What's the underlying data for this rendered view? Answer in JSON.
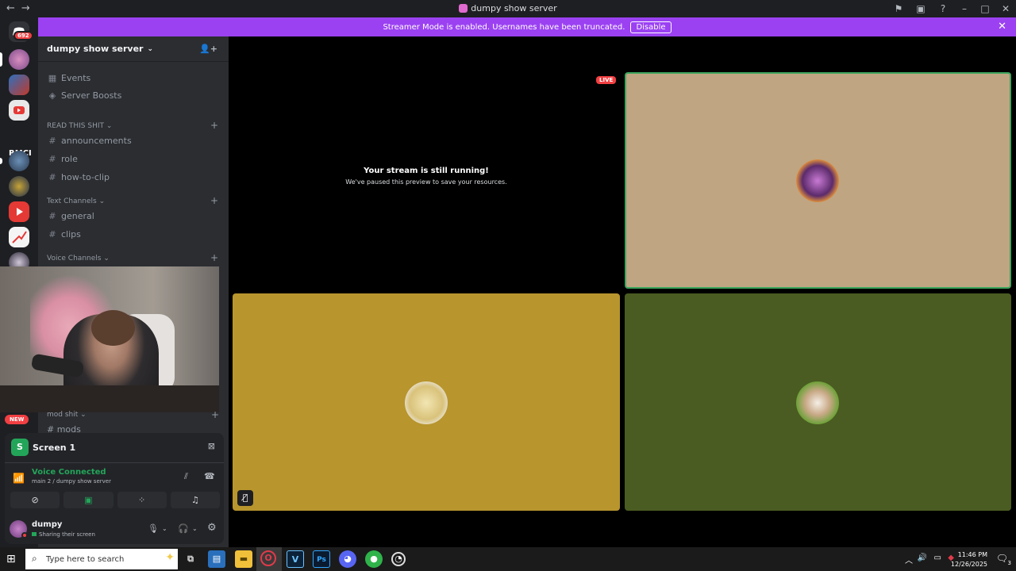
{
  "window": {
    "title": "dumpy show server",
    "back": "←",
    "forward": "→"
  },
  "banner": {
    "text": "Streamer Mode is enabled. Usernames have been truncated.",
    "disable_label": "Disable",
    "close": "✕"
  },
  "guild_rail": {
    "home_badge": "692",
    "rmci_label": "RMCI",
    "new_badge": "NEW"
  },
  "server": {
    "name": "dumpy show server",
    "chevron": "⌄"
  },
  "nav": {
    "events": "Events",
    "boosts": "Server Boosts"
  },
  "categories": {
    "read": "READ THIS SHIT",
    "text": "Text Channels",
    "voice": "Voice Channels",
    "mod": "mod shit"
  },
  "channels": {
    "announcements": "announcements",
    "role": "role",
    "how_to_clip": "how-to-clip",
    "general": "general",
    "clips": "clips",
    "mods": "mods"
  },
  "panel": {
    "screen_label": "Screen 1",
    "voice_status": "Voice Connected",
    "voice_location": "main 2 / dumpy show server",
    "user_name": "dumpy",
    "user_status": "Sharing their screen"
  },
  "stage": {
    "live": "LIVE",
    "paused_title": "Your stream is still running!",
    "paused_sub": "We've paused this preview to save your resources."
  },
  "colors": {
    "streamer_banner": "#9b41f2",
    "tile_beige": "#bfa582",
    "tile_gold": "#b8952d",
    "tile_green": "#4a5c21",
    "voice_green": "#23a559"
  },
  "taskbar": {
    "search_placeholder": "Type here to search",
    "time": "11:46 PM",
    "date": "12/26/2025",
    "notifications": "3"
  }
}
